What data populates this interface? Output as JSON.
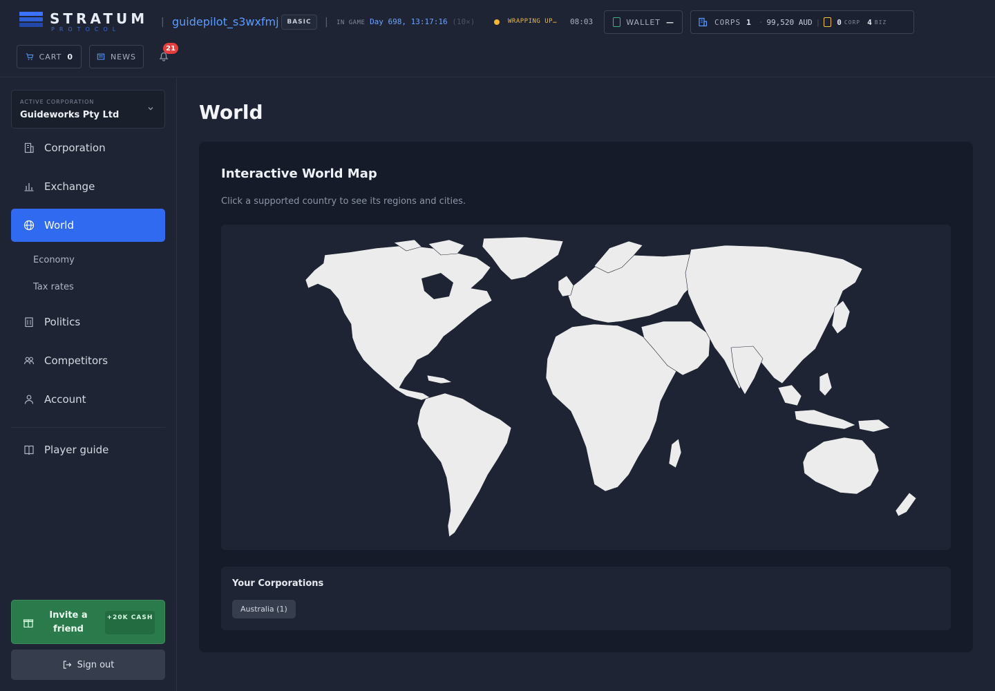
{
  "brand": {
    "name": "STRATUM",
    "sub": "PROTOCOL"
  },
  "header": {
    "username": "guidepilot_s3wxfmj",
    "plan_badge": "BASIC",
    "in_game_label": "IN GAME",
    "game_day": "Day 698, 13:17:16",
    "speed": "(10×)",
    "status_text": "WRAPPING UP…",
    "status_timer": "08:03",
    "wallet_label": "WALLET",
    "wallet_value": "—",
    "corps_label": "CORPS",
    "corps_count": "1",
    "balance": "99,520 AUD",
    "corp_count": "0",
    "corp_unit": "CORP",
    "biz_count": "4",
    "biz_unit": "BIZ",
    "cart_label": "CART",
    "cart_count": "0",
    "news_label": "NEWS",
    "notifications": "21"
  },
  "sidebar": {
    "active_corp_label": "ACTIVE CORPORATION",
    "active_corp_name": "Guideworks Pty Ltd",
    "items": [
      {
        "label": "Corporation",
        "icon": "building-icon"
      },
      {
        "label": "Exchange",
        "icon": "bar-chart-icon"
      },
      {
        "label": "World",
        "icon": "globe-icon",
        "active": true
      },
      {
        "label": "Politics",
        "icon": "government-icon"
      },
      {
        "label": "Competitors",
        "icon": "users-icon"
      },
      {
        "label": "Account",
        "icon": "user-icon"
      },
      {
        "label": "Player guide",
        "icon": "book-icon"
      }
    ],
    "sub_items": [
      "Economy",
      "Tax rates"
    ],
    "invite": {
      "text": "Invite a friend",
      "reward": "+20K CASH"
    },
    "sign_out": "Sign out"
  },
  "main": {
    "title": "World",
    "card_title": "Interactive World Map",
    "card_subtitle": "Click a supported country to see its regions and cities.",
    "your_corporations_label": "Your Corporations",
    "corporation_chips": [
      "Australia (1)"
    ]
  },
  "colors": {
    "accent": "#2f6af0",
    "background": "#1e2433",
    "invite_green": "#2b7a4b",
    "notification_red": "#e53e3e",
    "land": "#ececec"
  }
}
